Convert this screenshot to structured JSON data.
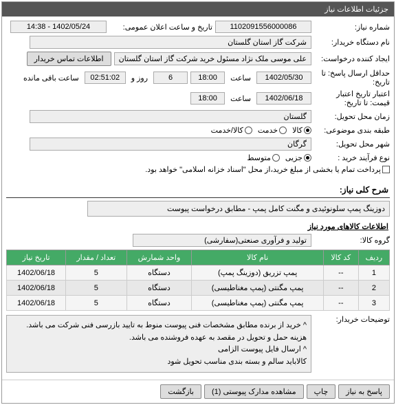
{
  "panel_title": "جزئیات اطلاعات نیاز",
  "labels": {
    "niaz_no": "شماره نیاز:",
    "date_public": "تاریخ و ساعت اعلان عمومی:",
    "buyer_name": "نام دستگاه خریدار:",
    "requester": "ایجاد کننده درخواست:",
    "deadline": "حداقل ارسال پاسخ: تا تاریخ:",
    "validity": "اعتبار تاریخ اعتبار قیمت: تا تاریخ:",
    "delivery_time": "زمان محل تحویل:",
    "subject_class": "طبقه بندی موضوعی:",
    "delivery_city": "شهر محل تحویل:",
    "process_type": "نوع فرآیند خرید :",
    "time": "ساعت",
    "day_and": "روز و",
    "remaining": "ساعت باقی مانده",
    "btn_contact": "اطلاعات تماس خریدار"
  },
  "values": {
    "niaz_no": "1102091556000086",
    "date_public": "1402/05/24 - 14:38",
    "buyer_name": "شرکت گاز استان گلستان",
    "requester": "علی موسی ملک نژاد مسئول خرید شرکت گاز استان گلستان",
    "deadline_date": "1402/05/30",
    "deadline_time": "18:00",
    "deadline_days": "6",
    "deadline_clock": "02:51:02",
    "validity_date": "1402/06/18",
    "validity_time": "18:00",
    "delivery_place": "گلستان",
    "delivery_city": "گرگان"
  },
  "subject_radios": [
    {
      "label": "کالا",
      "checked": true
    },
    {
      "label": "خدمت",
      "checked": false
    },
    {
      "label": "کالا/خدمت",
      "checked": false
    }
  ],
  "process_radios": [
    {
      "label": "جزیی",
      "checked": true
    },
    {
      "label": "متوسط",
      "checked": false
    }
  ],
  "process_check": {
    "label": "پرداخت تمام یا بخشی از مبلغ خرید،از محل \"اسناد خزانه اسلامی\" خواهد بود.",
    "checked": false
  },
  "section_desc_title": "شرح کلی نیاز:",
  "section_desc_value": "دوزینگ پمپ سلونوئیدی و مگنت کامل پمپ - مطابق درخواست پیوست",
  "section_goods_title": "اطلاعات کالاهای مورد نیاز",
  "group_label": "گروه کالا:",
  "group_value": "تولید و فرآوری صنعتی(سفارشی)",
  "table": {
    "headers": [
      "ردیف",
      "کد کالا",
      "نام کالا",
      "واحد شمارش",
      "تعداد / مقدار",
      "تاریخ نیاز"
    ],
    "rows": [
      [
        "1",
        "--",
        "پمپ تزریق (دوزینگ پمپ)",
        "دستگاه",
        "5",
        "1402/06/18"
      ],
      [
        "2",
        "--",
        "پمپ مگنتی (پمپ مغناطیسی)",
        "دستگاه",
        "5",
        "1402/06/18"
      ],
      [
        "3",
        "--",
        "پمپ مگنتی (پمپ مغناطیسی)",
        "دستگاه",
        "5",
        "1402/06/18"
      ]
    ]
  },
  "notes_label": "توضیحات خریدار:",
  "notes_lines": [
    "^ خرید از برنده مطابق مشخصات فنی پیوست منوط به تایید بازرسی فنی شرکت می باشد.",
    "هزینه حمل و تحویل در مقصد به عهده فروشنده می باشد.",
    "^ ارسال فایل پیوست الزامی",
    "کالاباید سالم و بسته بندی مناسب تحویل شود"
  ],
  "buttons": {
    "reply": "پاسخ به نیاز",
    "print": "چاپ",
    "attachments": "مشاهده مدارک پیوستی (1)",
    "back": "بازگشت"
  }
}
